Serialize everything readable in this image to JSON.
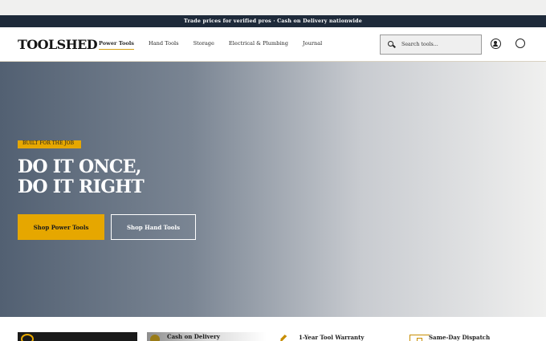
{
  "announcement": {
    "text": "Trade prices for verified pros · Cash on Delivery nationwide"
  },
  "header": {
    "logo": "TOOLSHED",
    "nav": [
      {
        "label": "Power Tools",
        "active": true
      },
      {
        "label": "Hand Tools",
        "active": false
      },
      {
        "label": "Storage",
        "active": false
      },
      {
        "label": "Electrical & Plumbing",
        "active": false
      },
      {
        "label": "Journal",
        "active": false
      }
    ],
    "search": {
      "placeholder": "Search tools..."
    },
    "icons": {
      "search": "search-icon",
      "account": "account-icon",
      "cart": "cart-icon"
    }
  },
  "hero": {
    "tag": "BUILT FOR THE JOB",
    "title": "DO IT ONCE,\nDO IT RIGHT",
    "primary_cta": "Shop Power Tools",
    "secondary_cta": "Shop Hand Tools"
  },
  "features": {
    "cod_title": "Cash on Delivery",
    "warranty": "1-Year Tool Warranty",
    "dispatch": "Same-Day Dispatch"
  },
  "colors": {
    "navy": "#1e2a3a",
    "accent": "#e6a700",
    "hero_gradient_start": "#526072",
    "hero_gradient_end": "#f0f0ef"
  }
}
